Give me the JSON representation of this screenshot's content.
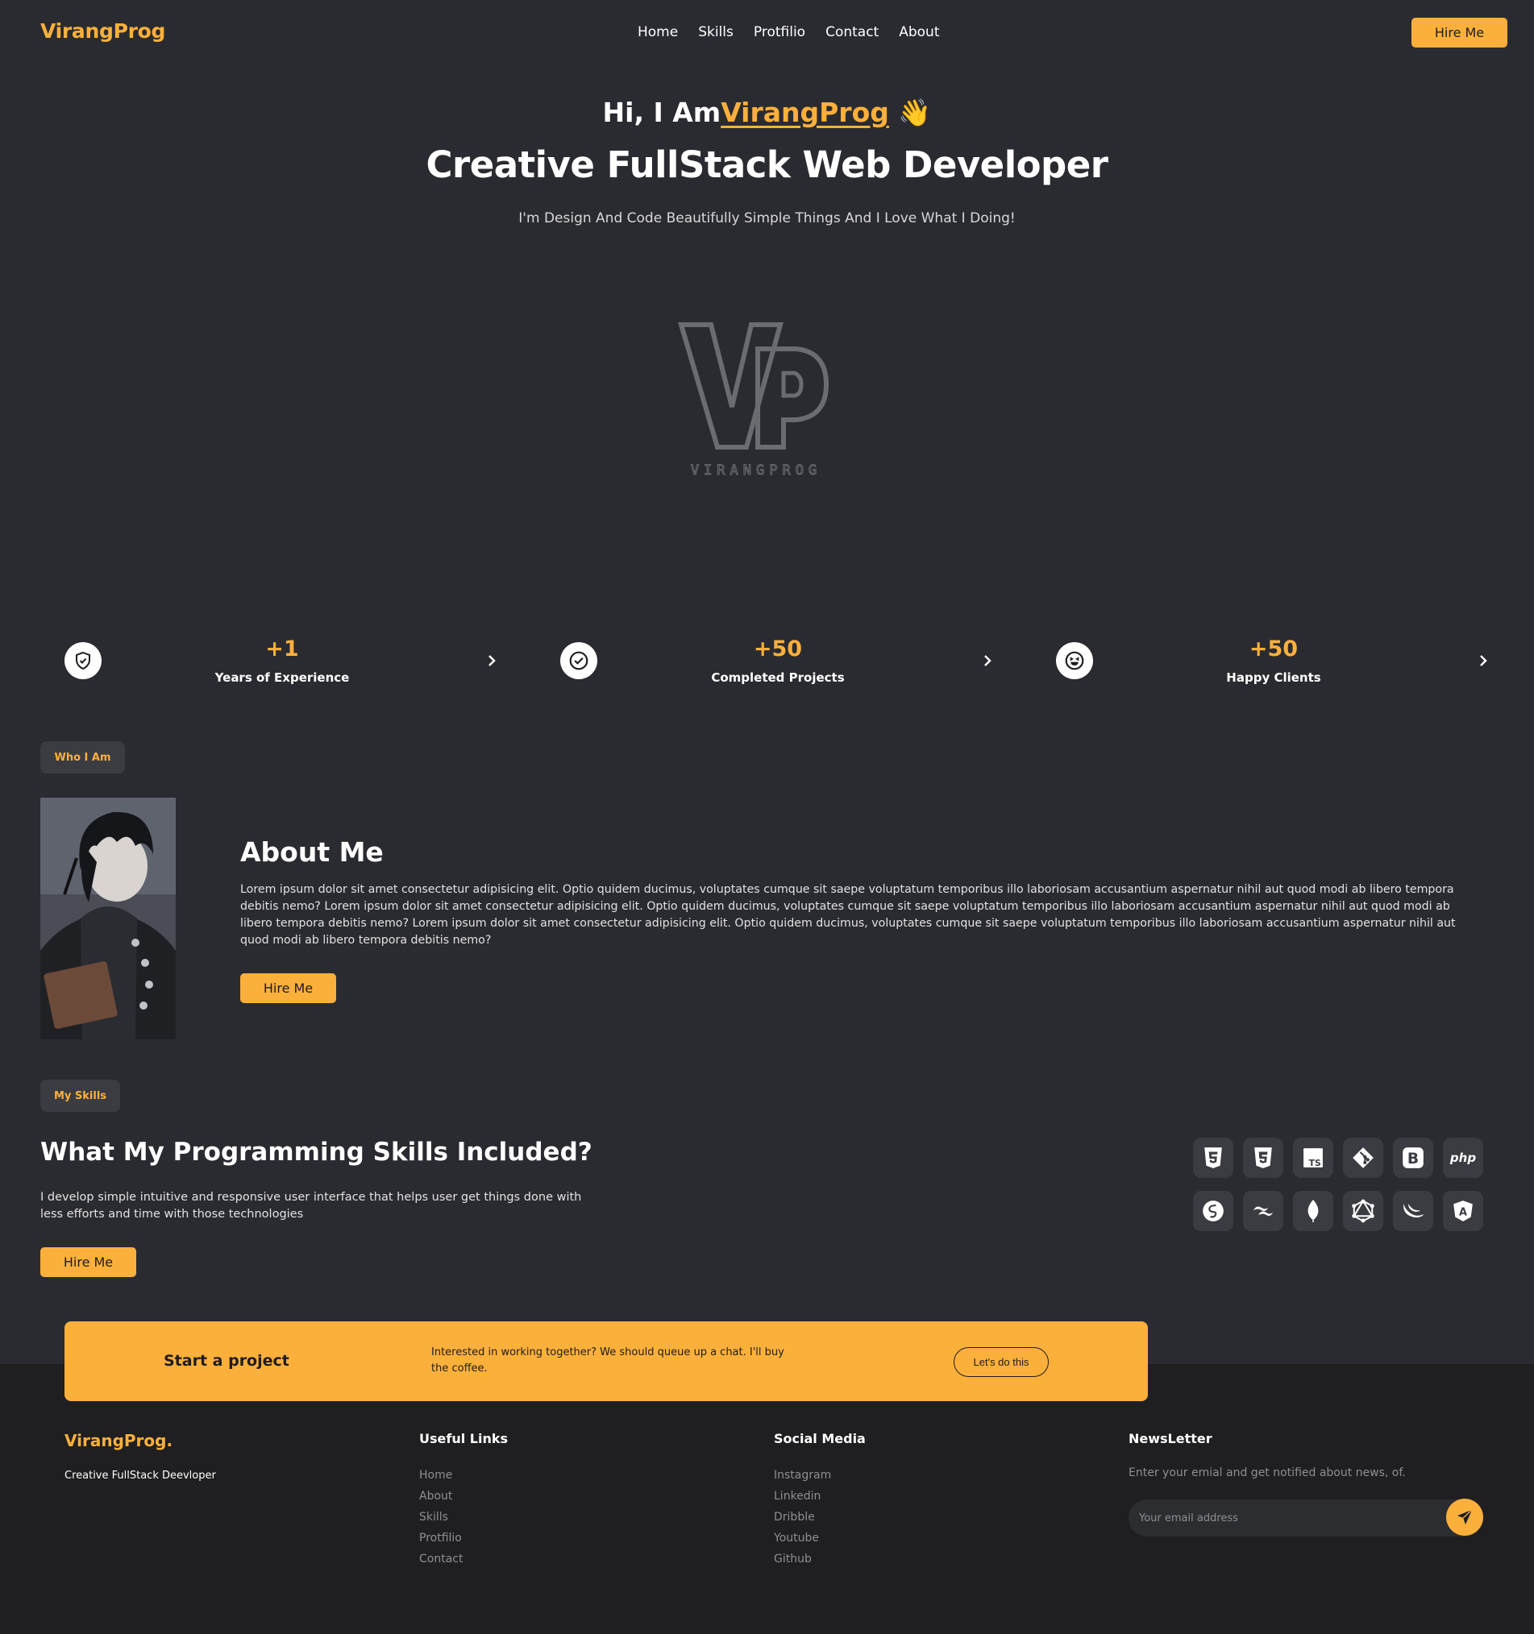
{
  "brand": {
    "name": "VirangProg",
    "accent": "#fcb03c",
    "background": "#2a2b30"
  },
  "nav": {
    "items": [
      "Home",
      "Skills",
      "Protfilio",
      "Contact",
      "About"
    ],
    "hire_label": "Hire Me"
  },
  "hero": {
    "greeting": "Hi, I Am",
    "name": "VirangProg",
    "wave": "👋",
    "title": "Creative FullStack Web Developer",
    "subtitle": "I'm Design And Code Beautifully Simple Things And I Love What I Doing!",
    "logo_monogram": "VP",
    "logo_wordmark": "VIRANGPROG"
  },
  "stats": [
    {
      "value": "+1",
      "label": "Years of Experience",
      "icon": "shield-check-icon"
    },
    {
      "value": "+50",
      "label": "Completed Projects",
      "icon": "check-circle-icon"
    },
    {
      "value": "+50",
      "label": "Happy Clients",
      "icon": "laughing-face-icon"
    }
  ],
  "about": {
    "tag": "Who I Am",
    "title": "About Me",
    "text": "Lorem ipsum dolor sit amet consectetur adipisicing elit. Optio quidem ducimus, voluptates cumque sit saepe voluptatum temporibus illo laboriosam accusantium aspernatur nihil aut quod modi ab libero tempora debitis nemo? Lorem ipsum dolor sit amet consectetur adipisicing elit. Optio quidem ducimus, voluptates cumque sit saepe voluptatum temporibus illo laboriosam accusantium aspernatur nihil aut quod modi ab libero tempora debitis nemo? Lorem ipsum dolor sit amet consectetur adipisicing elit. Optio quidem ducimus, voluptates cumque sit saepe voluptatum temporibus illo laboriosam accusantium aspernatur nihil aut quod modi ab libero tempora debitis nemo?",
    "hire_label": "Hire Me"
  },
  "skills": {
    "tag": "My Skills",
    "title": "What My Programming Skills Included?",
    "text": "I develop simple intuitive and responsive user interface that helps user get things done with less efforts and time with those technologies",
    "hire_label": "Hire Me",
    "icons": [
      "html5-icon",
      "css3-icon",
      "typescript-icon",
      "git-icon",
      "bootstrap-icon",
      "php-icon",
      "sass-icon",
      "tailwind-icon",
      "mongodb-icon",
      "graphql-icon",
      "jquery-icon",
      "angular-icon"
    ],
    "icon_text": {
      "typescript": "TS",
      "bootstrap": "B",
      "php": "php",
      "angular": "A"
    }
  },
  "cta": {
    "title": "Start a project",
    "text": "Interested in working together? We should queue up a chat. I'll buy the coffee.",
    "button": "Let's do this"
  },
  "footer": {
    "brand": "VirangProg.",
    "tagline": "Creative FullStack Deevloper",
    "useful_title": "Useful Links",
    "useful_links": [
      "Home",
      "About",
      "Skills",
      "Protfilio",
      "Contact"
    ],
    "social_title": "Social Media",
    "social_links": [
      "Instagram",
      "Linkedin",
      "Dribble",
      "Youtube",
      "Github"
    ],
    "newsletter_title": "NewsLetter",
    "newsletter_text": "Enter your emial and get notified about news, of.",
    "email_placeholder": "Your email address"
  }
}
